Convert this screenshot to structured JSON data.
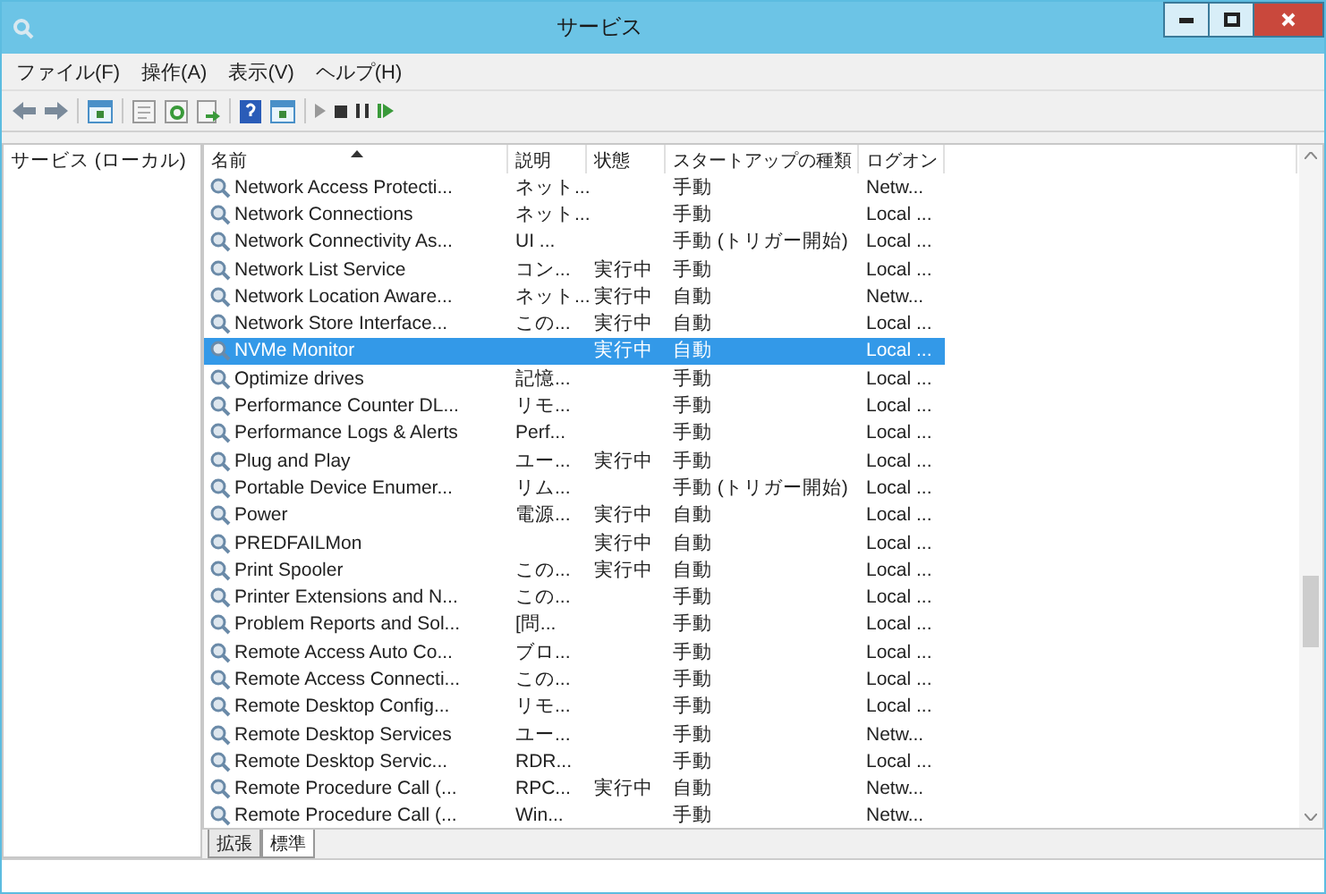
{
  "window": {
    "title": "サービス"
  },
  "menu": [
    "ファイル(F)",
    "操作(A)",
    "表示(V)",
    "ヘルプ(H)"
  ],
  "sidebar": {
    "items": [
      {
        "label": "サービス (ローカル)",
        "selected": false
      }
    ]
  },
  "table": {
    "columns": [
      "名前",
      "説明",
      "状態",
      "スタートアップの種類",
      "ログオン"
    ],
    "rows": [
      {
        "cells": [
          "Network Access Protecti...",
          "ネット...",
          "",
          "手動",
          "Netw..."
        ],
        "selected": false
      },
      {
        "cells": [
          "Network Connections",
          "ネット...",
          "",
          "手動",
          "Local ..."
        ],
        "selected": false
      },
      {
        "cells": [
          "Network Connectivity As...",
          "UI ...",
          "",
          "手動 (トリガー開始)",
          "Local ..."
        ],
        "selected": false
      },
      {
        "cells": [
          "Network List Service",
          "コン...",
          "実行中",
          "手動",
          "Local ..."
        ],
        "selected": false
      },
      {
        "cells": [
          "Network Location Aware...",
          "ネット...",
          "実行中",
          "自動",
          "Netw..."
        ],
        "selected": false
      },
      {
        "cells": [
          "Network Store Interface...",
          "この...",
          "実行中",
          "自動",
          "Local ..."
        ],
        "selected": false
      },
      {
        "cells": [
          "NVMe Monitor",
          "",
          "実行中",
          "自動",
          "Local ..."
        ],
        "selected": true
      },
      {
        "cells": [
          "Optimize drives",
          "記憶...",
          "",
          "手動",
          "Local ..."
        ],
        "selected": false
      },
      {
        "cells": [
          "Performance Counter DL...",
          "リモ...",
          "",
          "手動",
          "Local ..."
        ],
        "selected": false
      },
      {
        "cells": [
          "Performance Logs & Alerts",
          "Perf...",
          "",
          "手動",
          "Local ..."
        ],
        "selected": false
      },
      {
        "cells": [
          "Plug and Play",
          "ユー...",
          "実行中",
          "手動",
          "Local ..."
        ],
        "selected": false
      },
      {
        "cells": [
          "Portable Device Enumer...",
          "リム...",
          "",
          "手動 (トリガー開始)",
          "Local ..."
        ],
        "selected": false
      },
      {
        "cells": [
          "Power",
          "電源...",
          "実行中",
          "自動",
          "Local ..."
        ],
        "selected": false
      },
      {
        "cells": [
          "PREDFAILMon",
          "",
          "実行中",
          "自動",
          "Local ..."
        ],
        "selected": false
      },
      {
        "cells": [
          "Print Spooler",
          "この...",
          "実行中",
          "自動",
          "Local ..."
        ],
        "selected": false
      },
      {
        "cells": [
          "Printer Extensions and N...",
          "この...",
          "",
          "手動",
          "Local ..."
        ],
        "selected": false
      },
      {
        "cells": [
          "Problem Reports and Sol...",
          "[問...",
          "",
          "手動",
          "Local ..."
        ],
        "selected": false
      },
      {
        "cells": [
          "Remote Access Auto Co...",
          "ブロ...",
          "",
          "手動",
          "Local ..."
        ],
        "selected": false
      },
      {
        "cells": [
          "Remote Access Connecti...",
          "この...",
          "",
          "手動",
          "Local ..."
        ],
        "selected": false
      },
      {
        "cells": [
          "Remote Desktop Config...",
          "リモ...",
          "",
          "手動",
          "Local ..."
        ],
        "selected": false
      },
      {
        "cells": [
          "Remote Desktop Services",
          "ユー...",
          "",
          "手動",
          "Netw..."
        ],
        "selected": false
      },
      {
        "cells": [
          "Remote Desktop Servic...",
          "RDR...",
          "",
          "手動",
          "Local ..."
        ],
        "selected": false
      },
      {
        "cells": [
          "Remote Procedure Call (...",
          "RPC...",
          "実行中",
          "自動",
          "Netw..."
        ],
        "selected": false
      },
      {
        "cells": [
          "Remote Procedure Call (...",
          "Win...",
          "",
          "手動",
          "Netw..."
        ],
        "selected": false
      }
    ]
  },
  "tabs": [
    {
      "label": "拡張",
      "selected": false
    },
    {
      "label": "標準",
      "selected": true
    }
  ]
}
